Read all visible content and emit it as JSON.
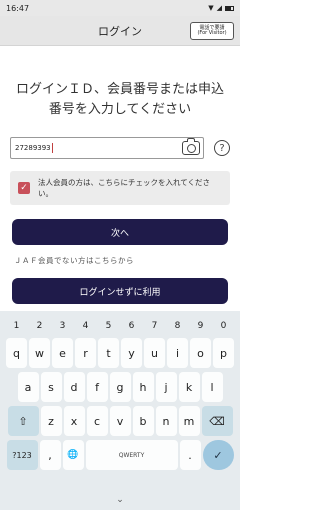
{
  "status_bar": {
    "time": "16:47"
  },
  "header": {
    "title": "ログイン",
    "visitor_button": {
      "line1": "電話で要請",
      "line2": "(For Visitor)"
    }
  },
  "prompt": {
    "line1": "ログインＩＤ、会員番号または申込",
    "line2": "番号を入力してください"
  },
  "id_input": {
    "value": "27289393"
  },
  "corporate_checkbox": {
    "checked": true,
    "label": "法人会員の方は、こちらにチェックを入れてください。"
  },
  "next_button": {
    "label": "次へ"
  },
  "non_member_link": {
    "label": "ＪＡＦ会員でない方はこちらから"
  },
  "login_without_button": {
    "label": "ログインせずに利用"
  },
  "keyboard": {
    "number_row": [
      "1",
      "2",
      "3",
      "4",
      "5",
      "6",
      "7",
      "8",
      "9",
      "0"
    ],
    "row1": [
      "q",
      "w",
      "e",
      "r",
      "t",
      "y",
      "u",
      "i",
      "o",
      "p"
    ],
    "row2": [
      "a",
      "s",
      "d",
      "f",
      "g",
      "h",
      "j",
      "k",
      "l"
    ],
    "row3": [
      "z",
      "x",
      "c",
      "v",
      "b",
      "n",
      "m"
    ],
    "symbols_key": "?123",
    "comma_key": ",",
    "globe_glyph": "🌐",
    "space_label": "QWERTY",
    "period_key": ".",
    "shift_glyph": "⇧",
    "backspace_glyph": "⌫",
    "enter_glyph": "✓"
  },
  "nav_bar": {
    "hide_keyboard_glyph": "⌄"
  },
  "colors": {
    "primary_button": "#1f1b4a",
    "checkbox": "#c8505a"
  }
}
